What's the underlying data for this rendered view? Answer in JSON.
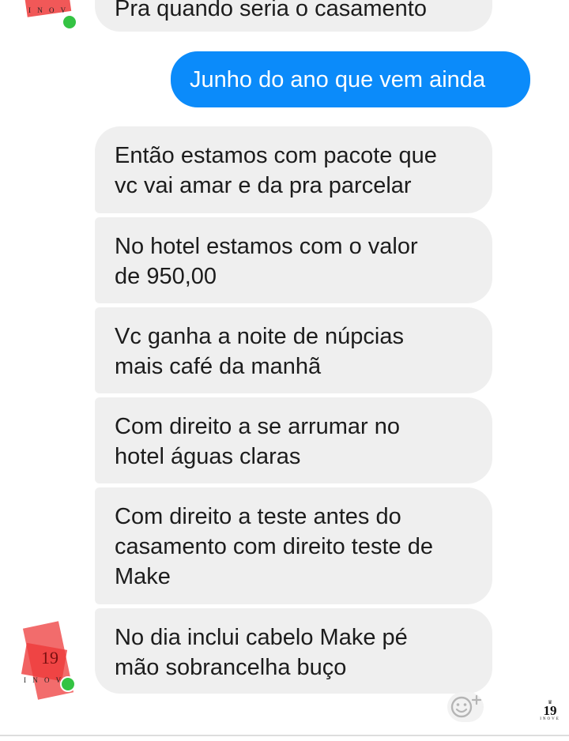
{
  "conversation": {
    "messages": [
      {
        "sender": "contact",
        "text": "Pra quando seria o casamento"
      },
      {
        "sender": "me",
        "text": "Junho do ano que vem ainda"
      },
      {
        "sender": "contact",
        "lines": [
          "Então estamos com pacote que",
          "vc vai amar e da pra parcelar"
        ]
      },
      {
        "sender": "contact",
        "lines": [
          "No hotel estamos com o valor",
          "de 950,00"
        ]
      },
      {
        "sender": "contact",
        "lines": [
          "Vc ganha a noite de núpcias",
          "mais café da manhã"
        ]
      },
      {
        "sender": "contact",
        "lines": [
          "Com direito a se arrumar no",
          "hotel águas claras"
        ]
      },
      {
        "sender": "contact",
        "lines": [
          "Com direito a teste antes do",
          "casamento com direito teste de",
          "Make"
        ]
      },
      {
        "sender": "contact",
        "lines": [
          "No dia inclui cabelo Make pé",
          "mão sobrancelha buço"
        ]
      }
    ]
  },
  "contact": {
    "avatar_monogram": "I N O V",
    "avatar_number": "19",
    "status": "online",
    "status_color": "#34c343"
  },
  "composer": {
    "icon": "smile-plus-icon"
  },
  "watermark": {
    "number": "19",
    "text": "INOVE"
  },
  "colors": {
    "outgoing_bubble": "#0b8bfa",
    "incoming_bubble": "#efefef",
    "redaction": "#ee3b3b"
  }
}
